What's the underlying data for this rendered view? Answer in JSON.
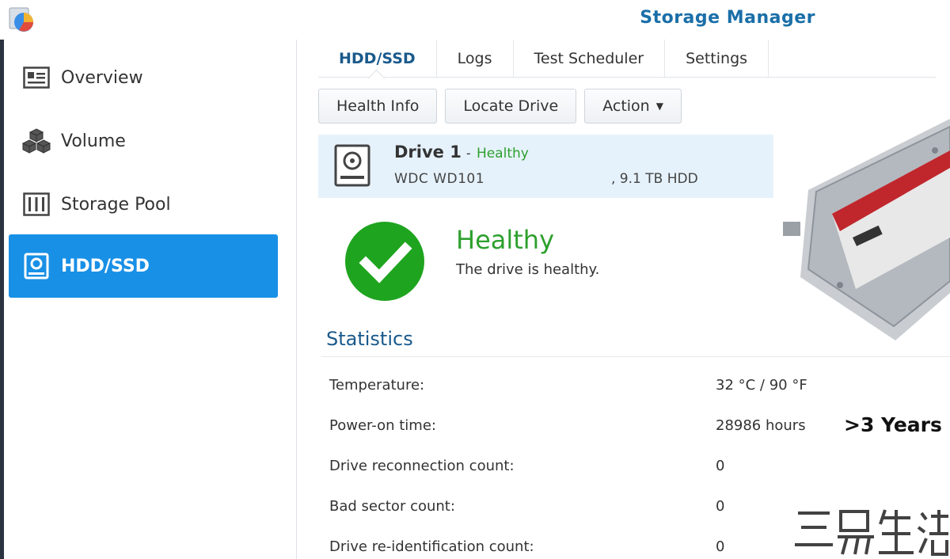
{
  "window": {
    "title": "Storage Manager"
  },
  "sidebar": {
    "items": [
      {
        "label": "Overview",
        "icon": "overview-icon",
        "active": false
      },
      {
        "label": "Volume",
        "icon": "volume-icon",
        "active": false
      },
      {
        "label": "Storage Pool",
        "icon": "storage-pool-icon",
        "active": false
      },
      {
        "label": "HDD/SSD",
        "icon": "hdd-icon",
        "active": true
      }
    ]
  },
  "tabs": [
    {
      "label": "HDD/SSD",
      "active": true
    },
    {
      "label": "Logs",
      "active": false
    },
    {
      "label": "Test Scheduler",
      "active": false
    },
    {
      "label": "Settings",
      "active": false
    }
  ],
  "toolbar": {
    "health_info": "Health Info",
    "locate_drive": "Locate Drive",
    "action": "Action"
  },
  "drive": {
    "name": "Drive 1",
    "separator": "-",
    "status": "Healthy",
    "model": "WDC WD101",
    "capacity": ", 9.1 TB HDD"
  },
  "health": {
    "title": "Healthy",
    "description": "The drive is healthy."
  },
  "statistics": {
    "title": "Statistics",
    "rows": [
      {
        "label": "Temperature:",
        "value": "32 °C / 90 °F"
      },
      {
        "label": "Power-on time:",
        "value": "28986 hours"
      },
      {
        "label": "Drive reconnection count:",
        "value": "0"
      },
      {
        "label": "Bad sector count:",
        "value": "0"
      },
      {
        "label": "Drive re-identification count:",
        "value": "0"
      }
    ]
  },
  "annotation": ">3 Years",
  "colors": {
    "accent": "#1890e6",
    "title": "#1a6fa8",
    "healthy": "#2ea02e",
    "selected_row": "#e6f2fb"
  }
}
